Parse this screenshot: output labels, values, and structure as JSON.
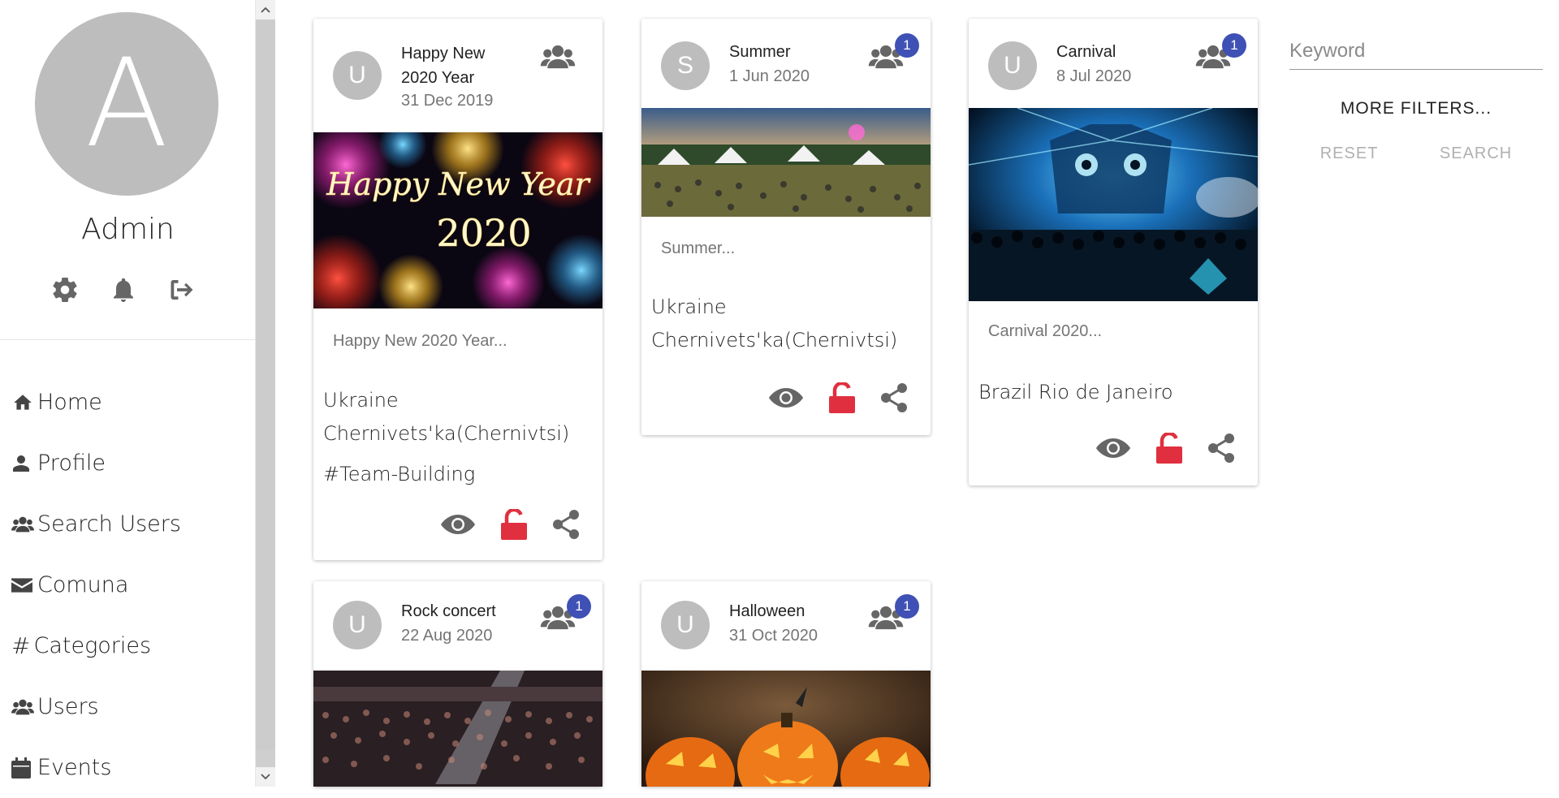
{
  "profile": {
    "avatar_letter": "A",
    "name": "Admin"
  },
  "nav": [
    {
      "label": "Home",
      "icon": "home-icon"
    },
    {
      "label": "Profile",
      "icon": "user-icon"
    },
    {
      "label": "Search Users",
      "icon": "users-icon"
    },
    {
      "label": "Comuna",
      "icon": "envelope-icon"
    },
    {
      "label": "Categories",
      "icon": "hash-icon"
    },
    {
      "label": "Users",
      "icon": "users-icon"
    },
    {
      "label": "Events",
      "icon": "calendar-icon"
    }
  ],
  "events": [
    {
      "avatar": "U",
      "title": "Happy New 2020 Year",
      "date": "31 Dec 2019",
      "badge": "",
      "image_text": "Happy New Year 2020",
      "description": "Happy New 2020 Year...",
      "location_line1": "Ukraine",
      "location_line2": "Chernivets'ka(Chernivtsi)",
      "tag": "#Team-Building"
    },
    {
      "avatar": "S",
      "title": "Summer",
      "date": "1 Jun 2020",
      "badge": "1",
      "description": "Summer...",
      "location_line1": "Ukraine",
      "location_line2": "Chernivets'ka(Chernivtsi)"
    },
    {
      "avatar": "U",
      "title": "Carnival",
      "date": "8 Jul 2020",
      "badge": "1",
      "description": "Carnival 2020...",
      "location_line1": "Brazil Rio de Janeiro"
    },
    {
      "avatar": "U",
      "title": "Rock concert",
      "date": "22 Aug 2020",
      "badge": "1"
    },
    {
      "avatar": "U",
      "title": "Halloween",
      "date": "31 Oct 2020",
      "badge": "1"
    }
  ],
  "filters": {
    "keyword_placeholder": "Keyword",
    "more_filters_label": "MORE FILTERS...",
    "reset_label": "RESET",
    "search_label": "SEARCH"
  },
  "colors": {
    "badge": "#3f51b5",
    "unlock": "#e0303f",
    "icon_gray": "#666666",
    "avatar_gray": "#bdbdbd"
  }
}
